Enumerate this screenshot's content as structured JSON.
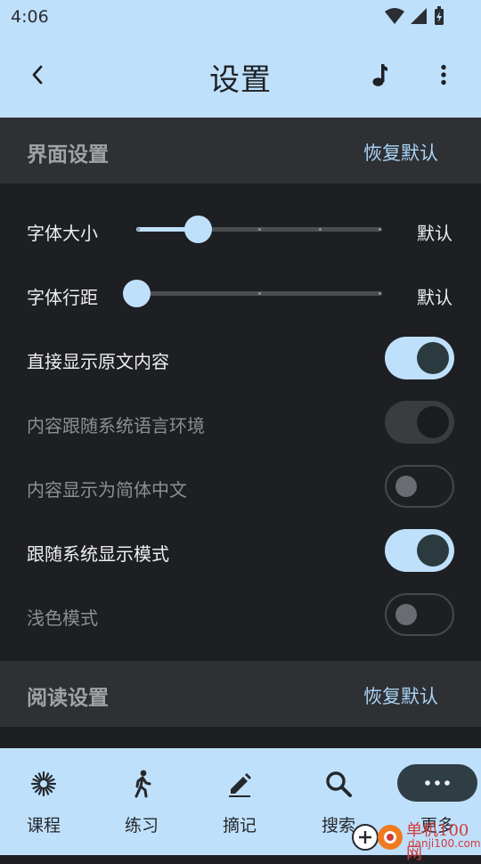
{
  "status_bar": {
    "time": "4:06"
  },
  "app_bar": {
    "title": "设置"
  },
  "sections": {
    "interface": {
      "title": "界面设置",
      "reset_label": "恢复默认"
    },
    "reading": {
      "title": "阅读设置",
      "reset_label": "恢复默认"
    }
  },
  "settings": {
    "font_size": {
      "label": "字体大小",
      "value": "默认",
      "level": 0.25
    },
    "line_spacing": {
      "label": "字体行距",
      "value": "默认",
      "level": 0.0
    },
    "show_original": {
      "label": "直接显示原文内容",
      "state": "on"
    },
    "follow_system_language": {
      "label": "内容跟随系统语言环境",
      "state": "on-disabled"
    },
    "simplified_chinese": {
      "label": "内容显示为简体中文",
      "state": "off"
    },
    "follow_system_display": {
      "label": "跟随系统显示模式",
      "state": "on"
    },
    "light_mode": {
      "label": "浅色模式",
      "state": "off"
    }
  },
  "bottom_nav": {
    "items": [
      {
        "label": "课程",
        "icon": "sparkle-icon"
      },
      {
        "label": "练习",
        "icon": "walking-person-icon"
      },
      {
        "label": "摘记",
        "icon": "pencil-icon"
      },
      {
        "label": "搜索",
        "icon": "search-icon"
      },
      {
        "label": "更多",
        "icon": "more-horizontal-icon"
      }
    ]
  },
  "watermark": {
    "brand": "单机100网",
    "url": "danji100.com"
  },
  "colors": {
    "app_bar": "#bfe0fb",
    "background": "#1e1f23",
    "section_header": "#2e3033",
    "accent": "#a9d4f8"
  }
}
